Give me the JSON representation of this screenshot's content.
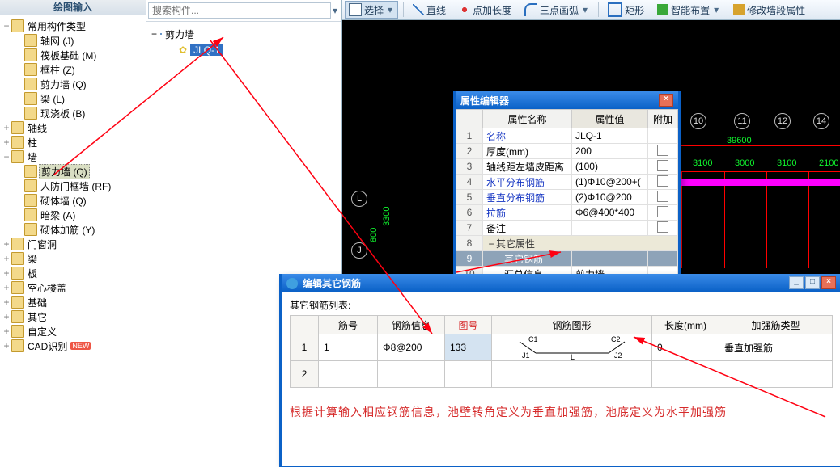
{
  "left_panel_title": "绘图输入",
  "left_tree": {
    "n0": "常用构件类型",
    "n0_0": "轴网 (J)",
    "n0_1": "筏板基础 (M)",
    "n0_2": "框柱 (Z)",
    "n0_3": "剪力墙 (Q)",
    "n0_4": "梁 (L)",
    "n0_5": "现浇板 (B)",
    "n1": "轴线",
    "n2": "柱",
    "n3": "墙",
    "n3_0": "剪力墙 (Q)",
    "n3_1": "人防门框墙 (RF)",
    "n3_2": "砌体墙 (Q)",
    "n3_3": "暗梁 (A)",
    "n3_4": "砌体加筋 (Y)",
    "n4": "门窗洞",
    "n5": "梁",
    "n6": "板",
    "n7": "空心楼盖",
    "n8": "基础",
    "n9": "其它",
    "n10": "自定义",
    "n11": "CAD识别",
    "new_badge": "NEW"
  },
  "search_placeholder": "搜索构件...",
  "mid_tree": {
    "root": "剪力墙",
    "item": "JLQ-1"
  },
  "toolbar": {
    "select": "选择",
    "line": "直线",
    "point_extend": "点加长度",
    "arc3": "三点画弧",
    "rect": "矩形",
    "smart": "智能布置",
    "edit_seg": "修改墙段属性"
  },
  "canvas": {
    "dim_800": "800",
    "dim_3300": "3300",
    "dim_39600": "39600",
    "dim_3100a": "3100",
    "dim_3000": "3000",
    "dim_3100b": "3100",
    "dim_2100": "2100",
    "axis10": "10",
    "axis11": "11",
    "axis12": "12",
    "axis14": "14",
    "axisL": "L",
    "axisJ": "J"
  },
  "prop_win": {
    "title": "属性编辑器",
    "col_name": "属性名称",
    "col_value": "属性值",
    "col_extra": "附加",
    "rows": {
      "r1_n": "名称",
      "r1_v": "JLQ-1",
      "r2_n": "厚度(mm)",
      "r2_v": "200",
      "r3_n": "轴线距左墙皮距离",
      "r3_v": "(100)",
      "r4_n": "水平分布钢筋",
      "r4_v": "(1)Φ10@200+(",
      "r5_n": "垂直分布钢筋",
      "r5_v": "(2)Φ10@200",
      "r6_n": "拉筋",
      "r6_v": "Φ6@400*400",
      "r7_n": "备注",
      "r7_v": "",
      "r8_n": "其它属性",
      "r9_n": "其它钢筋",
      "r10_n": "汇总信息",
      "r10_v": "剪力墙"
    }
  },
  "steel_win": {
    "title": "编辑其它钢筋",
    "list_label": "其它钢筋列表:",
    "cols": {
      "c1": "筋号",
      "c2": "钢筋信息",
      "c3": "图号",
      "c4": "钢筋图形",
      "c5": "长度(mm)",
      "c6": "加强筋类型"
    },
    "row1": {
      "num": "1",
      "info": "Φ8@200",
      "fig_no": "133",
      "length": "0",
      "type": "垂直加强筋",
      "shape_c1": "C1",
      "shape_c2": "C2",
      "shape_j1": "J1",
      "shape_j2": "J2",
      "shape_l": "L"
    },
    "note": "根据计算输入相应钢筋信息，池壁转角定义为垂直加强筋，池底定义为水平加强筋"
  }
}
